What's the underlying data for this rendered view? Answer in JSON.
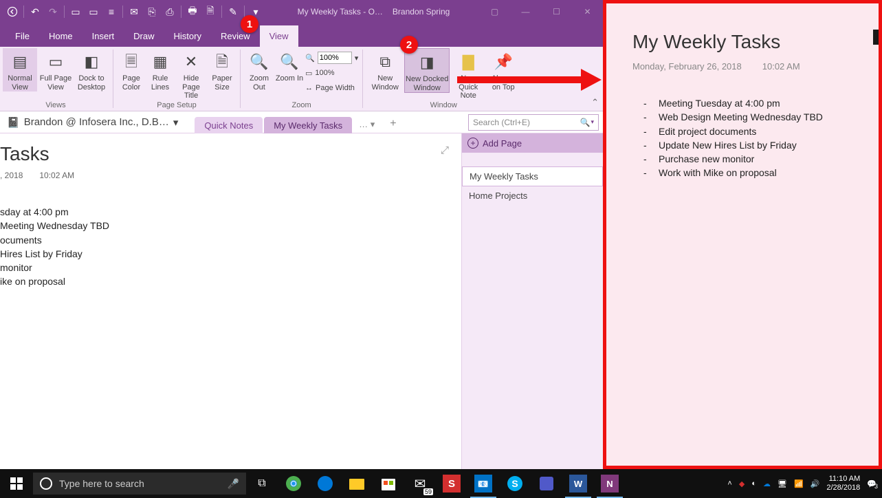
{
  "title_bar": {
    "doc": "My Weekly Tasks  -  O…",
    "user": "Brandon Spring"
  },
  "menu": [
    "File",
    "Home",
    "Insert",
    "Draw",
    "History",
    "Review",
    "View"
  ],
  "menu_active": 6,
  "ribbon": {
    "views": {
      "normal": "Normal View",
      "full": "Full Page View",
      "dock": "Dock to Desktop",
      "label": "Views"
    },
    "page_setup": {
      "color": "Page Color",
      "rule": "Rule Lines",
      "hide": "Hide Page Title",
      "paper": "Paper Size",
      "label": "Page Setup"
    },
    "zoom": {
      "out": "Zoom Out",
      "in": "Zoom In",
      "pct": "100%",
      "p100": "100%",
      "width": "Page Width",
      "label": "Zoom"
    },
    "window": {
      "new": "New Window",
      "docked": "New Docked Window",
      "note": "New Quick Note",
      "top": "Always on Top",
      "label": "Window"
    }
  },
  "notebook": "Brandon @ Infosera Inc., D.B…",
  "sections": {
    "quick": "Quick Notes",
    "weekly": "My Weekly Tasks",
    "more": "…"
  },
  "search_ph": "Search (Ctrl+E)",
  "page": {
    "title_partial": "  Tasks",
    "date_partial": ", 2018",
    "time": "10:02 AM",
    "lines": [
      "sday at 4:00 pm",
      "Meeting Wednesday TBD",
      "ocuments",
      "Hires List by Friday",
      " monitor",
      "ike on proposal"
    ]
  },
  "page_list": {
    "add": "Add Page",
    "items": [
      "My Weekly Tasks",
      "Home Projects"
    ]
  },
  "docked": {
    "title": "My Weekly Tasks",
    "date": "Monday, February 26, 2018",
    "time": "10:02 AM",
    "items": [
      "Meeting Tuesday at 4:00 pm",
      "Web Design Meeting Wednesday TBD",
      "Edit project documents",
      "Update New Hires List by Friday",
      "Purchase new monitor",
      "Work with Mike on proposal"
    ]
  },
  "badges": {
    "b1": "1",
    "b2": "2"
  },
  "taskbar": {
    "search_ph": "Type here to search",
    "time": "11:10 AM",
    "date": "2/28/2018",
    "mail_badge": "59",
    "notif": "3"
  }
}
